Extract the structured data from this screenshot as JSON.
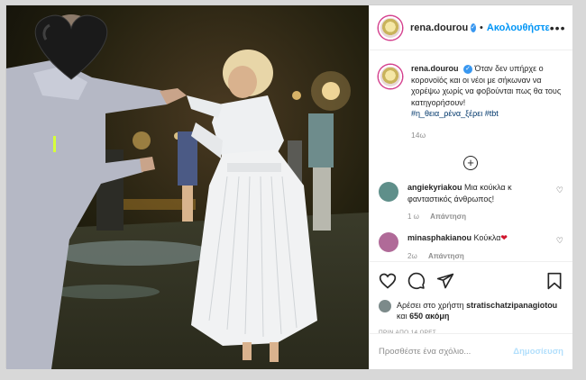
{
  "post": {
    "username": "rena.dourou",
    "follow_label": "Ακολουθήστε",
    "caption": {
      "username": "rena.dourou",
      "text": "Όταν δεν υπήρχε ο κορονοϊός και οι νέοι με σήκωναν να χορέψω χωρίς να φοβούνται πως θα τους κατηγορήσουν!",
      "hashtags": "#η_θεια_ρένα_ξέρει #tbt",
      "time": "14ω"
    },
    "comments": [
      {
        "username": "angiekyriakou",
        "text": "Μια κούκλα κ φανταστικός άνθρωπος!",
        "time": "1 ω",
        "reply_label": "Απάντηση",
        "avatar_color": "#5f8f8a"
      },
      {
        "username": "minasphakianou",
        "text": "Κούκλα",
        "emoji": "❤",
        "time": "2ω",
        "reply_label": "Απάντηση",
        "avatar_color": "#b06a98"
      }
    ],
    "likes": {
      "prefix": "Αρέσει στο χρήστη",
      "user": "stratischatzipanagiotou",
      "and": "και",
      "count": "650 ακόμη"
    },
    "posted_ago": "ΠΡΙΝ ΑΠΟ 14 ΩΡΕΣ",
    "add_comment_placeholder": "Προσθέστε ένα σχόλιο...",
    "post_button": "Δημοσίευση"
  },
  "colors": {
    "accent": "#0095f6",
    "verified": "#3897f0",
    "muted": "#8e8e8e"
  },
  "icons": [
    "verified-badge-icon",
    "more-options-icon",
    "load-more-icon",
    "heart-icon",
    "comment-icon",
    "share-icon",
    "bookmark-icon",
    "black-heart-sticker-icon"
  ]
}
